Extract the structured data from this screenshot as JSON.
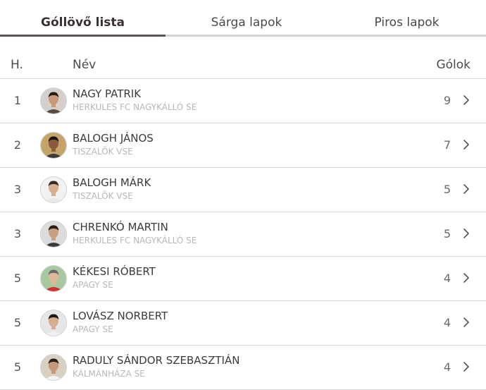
{
  "tabs": [
    {
      "label": "Góllövő lista",
      "active": true
    },
    {
      "label": "Sárga lapok",
      "active": false
    },
    {
      "label": "Piros lapok",
      "active": false
    }
  ],
  "table": {
    "headers": {
      "rank": "H.",
      "name": "Név",
      "goals": "Gólok"
    },
    "rows": [
      {
        "rank": "1",
        "name": "NAGY PATRIK",
        "team": "HERKULES FC NAGYKÁLLÓ SE",
        "goals": "9"
      },
      {
        "rank": "2",
        "name": "BALOGH JÁNOS",
        "team": "TISZALÖK VSE",
        "goals": "7"
      },
      {
        "rank": "3",
        "name": "BALOGH MÁRK",
        "team": "TISZALÖK VSE",
        "goals": "5"
      },
      {
        "rank": "3",
        "name": "CHRENKÓ MARTIN",
        "team": "HERKULES FC NAGYKÁLLÓ SE",
        "goals": "5"
      },
      {
        "rank": "5",
        "name": "KÉKESI RÓBERT",
        "team": "APAGY SE",
        "goals": "4"
      },
      {
        "rank": "5",
        "name": "LOVÁSZ NORBERT",
        "team": "APAGY SE",
        "goals": "4"
      },
      {
        "rank": "5",
        "name": "RADULY SÁNDOR SZEBASZTIÁN",
        "team": "KÁLMÁNHÁZA SE",
        "goals": "4"
      }
    ]
  },
  "colors": {
    "active_tab_underline": "#5a5458",
    "inactive_tab_underline": "#d4d4d4",
    "row_divider": "#d8d8d8",
    "team_text": "#b8b8b8"
  },
  "icons": {
    "row_action": "chevron-right-icon",
    "player_photo": "avatar"
  }
}
